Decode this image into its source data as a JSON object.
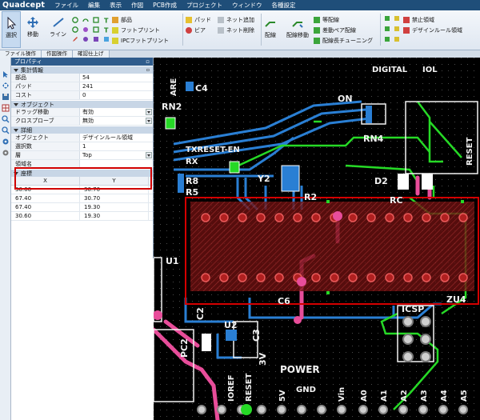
{
  "app": {
    "logo": "Quadcept"
  },
  "menu": [
    "ファイル",
    "編集",
    "表示",
    "作図",
    "PCB作成",
    "プロジェクト",
    "ウィンドウ",
    "各種設定"
  ],
  "ribbon": {
    "select": "選択",
    "move": "移動",
    "line": "ライン",
    "parts": "部品",
    "footprint": "フットプリント",
    "ipc_footprint": "IPCフットプリント",
    "pad": "パッド",
    "via": "ビア",
    "net_add": "ネット追加",
    "net_delete": "ネット削除",
    "wiring": "配線",
    "wiring_move": "配線移動",
    "equal_length": "等配線",
    "diff_pair": "差動ペア配線",
    "length_tuning": "配線長チューニング",
    "keepout": "禁止領域",
    "drc_area": "デザインルール領域"
  },
  "tabs": [
    "ファイル操作",
    "作図操作",
    "確認仕上げ"
  ],
  "panel": {
    "title": "プロパティ",
    "pin": "▫",
    "sections": {
      "summary": "集計情報",
      "object": "オブジェクト",
      "detail": "詳細",
      "coords": "座標"
    },
    "summary_rows": [
      {
        "k": "部品",
        "v": "54"
      },
      {
        "k": "パッド",
        "v": "241"
      },
      {
        "k": "コスト",
        "v": "0"
      }
    ],
    "object_rows": [
      {
        "k": "ドラッグ移動",
        "v": "有効"
      },
      {
        "k": "クロスプローブ",
        "v": "無効"
      }
    ],
    "detail_rows": [
      {
        "k": "オブジェクト",
        "v": "デザインルール領域"
      },
      {
        "k": "選択数",
        "v": "1"
      },
      {
        "k": "層",
        "v": "Top"
      },
      {
        "k": "領域名",
        "v": ""
      }
    ],
    "coord_headers": {
      "x": "X",
      "y": "Y"
    },
    "coords": [
      {
        "x": "30.60",
        "y": "30.70"
      },
      {
        "x": "67.40",
        "y": "30.70"
      },
      {
        "x": "67.40",
        "y": "19.30"
      },
      {
        "x": "30.60",
        "y": "19.30"
      }
    ]
  },
  "pcb": {
    "labels": {
      "digital": "DIGITAL",
      "iol": "IOL",
      "are": "ARE",
      "c4": "C4",
      "rn2": "RN2",
      "on": "ON",
      "rn4": "RN4",
      "reset_vert": "RESET",
      "txreset": "TXRESET-EN",
      "rx": "RX",
      "r8": "R8",
      "r5": "R5",
      "y2": "Y2",
      "r2": "R2",
      "d2": "D2",
      "rc": "RC",
      "u1": "U1",
      "c6": "C6",
      "zu4": "ZU4",
      "icsp": "ICSP",
      "c2": "C2",
      "u2": "U2",
      "c3": "C3",
      "pc2": "PC2",
      "v3": "3V",
      "power": "POWER",
      "gnd": "GND",
      "reset_b": "RESET",
      "v5": "5V",
      "vin": "Vin",
      "ioref": "IOREF",
      "a0": "A0",
      "a1": "A1",
      "a2": "A2",
      "a3": "A3",
      "a4": "A4",
      "a5": "A5"
    },
    "colors": {
      "trace_blue": "#2a7fd4",
      "trace_green": "#26d926",
      "pad_pink": "#e84d9a",
      "silk": "#f2f2f2",
      "selection": "#d40000",
      "grid": "#3a3a3a"
    }
  }
}
